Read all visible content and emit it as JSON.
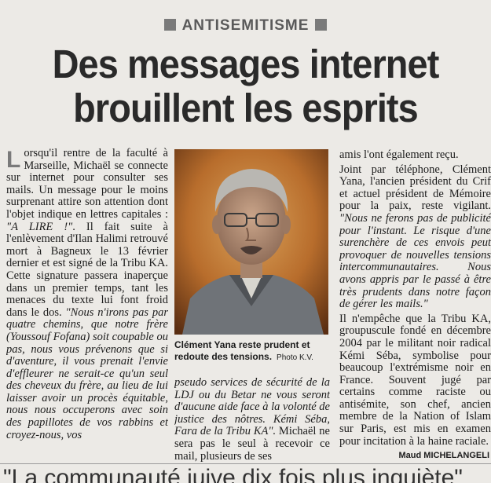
{
  "article": {
    "kicker": "ANTISEMITISME",
    "headline_line1": "Des messages internet",
    "headline_line2": "brouillent les esprits",
    "dropcap": "L",
    "col1_p1": "orsqu'il rentre de la faculté à Marseille, Michaël se connecte sur internet pour consulter ses mails. Un message pour le moins surprenant attire son attention dont l'objet indique en lettres capitales : ",
    "col1_p1_em": "\"A LIRE !\"",
    "col1_p2": ". Il fait suite à l'enlèvement d'Ilan Halimi retrouvé mort à Bagneux le 13 février dernier et est signé de la Tribu KA. Cette signature passera inaperçue dans un premier temps, tant les menaces du texte lui font froid dans le dos. ",
    "col1_em2": "\"Nous n'irons pas par quatre chemins, que notre frère (Youssouf Fofana) soit coupable ou pas, nous vous prévenons que si d'aventure, il vous prenait l'envie d'effleurer ne serait-ce qu'un seul des cheveux du frère, au lieu de lui laisser avoir un procès équitable, nous nous occuperons avec soin des papillotes de vos rabbins et croyez-nous, vos",
    "caption": "Clément Yana reste prudent et redoute des tensions.",
    "credit": "Photo K.V.",
    "col2_em": "pseudo services de sécurité de la LDJ ou du Betar ne vous seront d'aucune aide face à la volonté de justice des nôtres. Kémi Séba, Fara de la Tribu KA\".",
    "col2_text": " Michaël ne sera pas le seul à recevoir ce mail, plusieurs de ses",
    "col3_p1": "amis l'ont également reçu.",
    "col3_p2": "Joint par téléphone, Clément Yana, l'ancien président du Crif et actuel président de Mémoire pour la paix, reste vigilant. ",
    "col3_p2_em": "\"Nous ne ferons pas de publicité pour l'instant. Le risque d'une surenchère de ces envois peut provoquer de nouvelles tensions intercommunautaires. Nous avons appris par le passé à être très prudents dans notre façon de gérer les mails.\"",
    "col3_p3": "Il n'empêche que la Tribu KA, groupuscule fondé en décembre 2004 par le militant noir radical Kémi Séba, symbolise pour beaucoup l'extrémisme noir en France. Souvent jugé par certains comme raciste ou antisémite, son chef, ancien membre de la Nation of Islam sur Paris, est mis en examen pour incitation à la haine raciale.",
    "byline": "Maud MICHELANGELI",
    "bottom_quote": "\"La communauté juive dix fois plus inquiète\""
  }
}
